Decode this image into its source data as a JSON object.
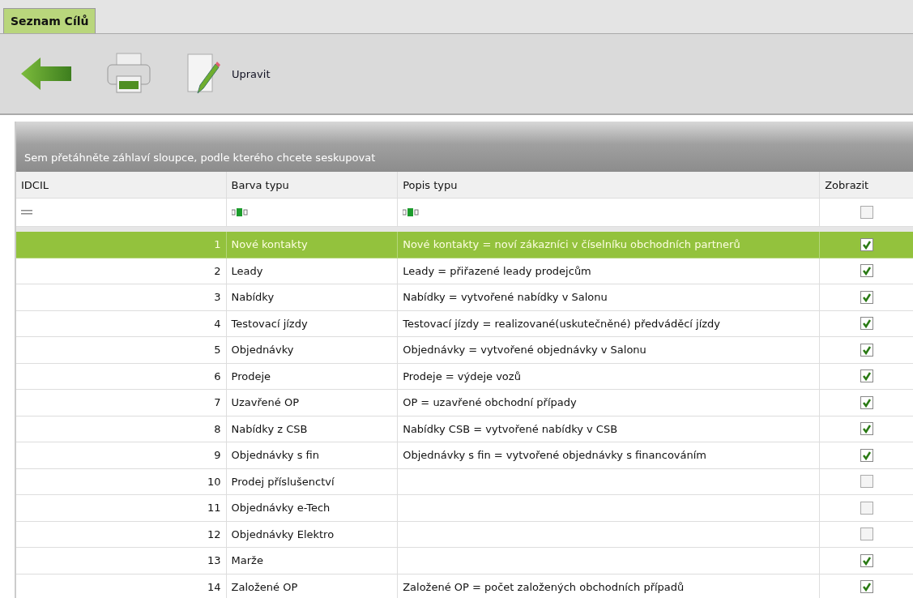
{
  "tabs": [
    {
      "label": "Seznam Cílů",
      "selected": true
    }
  ],
  "toolbar": {
    "edit_label": "Upravit"
  },
  "grid": {
    "group_hint": "Sem přetáhněte záhlaví sloupce, podle kterého chcete seskupovat",
    "columns": [
      "IDCIL",
      "Barva typu",
      "Popis typu",
      "Zobrazit"
    ],
    "filter": {
      "checked": false
    },
    "rows": [
      {
        "id": "1",
        "name": "Nové kontakty",
        "description": "Nové kontakty = noví zákazníci v číselníku obchodních partnerů",
        "shown": true,
        "selected": true
      },
      {
        "id": "2",
        "name": "Leady",
        "description": "Leady = přiřazené leady prodejcům",
        "shown": true,
        "selected": false
      },
      {
        "id": "3",
        "name": "Nabídky",
        "description": "Nabídky = vytvořené nabídky v Salonu",
        "shown": true,
        "selected": false
      },
      {
        "id": "4",
        "name": "Testovací jízdy",
        "description": "Testovací jízdy = realizované(uskutečněné) předváděcí jízdy",
        "shown": true,
        "selected": false
      },
      {
        "id": "5",
        "name": "Objednávky",
        "description": "Objednávky = vytvořené objednávky v Salonu",
        "shown": true,
        "selected": false
      },
      {
        "id": "6",
        "name": "Prodeje",
        "description": "Prodeje = výdeje vozů",
        "shown": true,
        "selected": false
      },
      {
        "id": "7",
        "name": "Uzavřené OP",
        "description": "OP = uzavřené obchodní případy",
        "shown": true,
        "selected": false
      },
      {
        "id": "8",
        "name": "Nabídky z CSB",
        "description": "Nabídky CSB = vytvořené nabídky v CSB",
        "shown": true,
        "selected": false
      },
      {
        "id": "9",
        "name": "Objednávky s fin",
        "description": "Objednávky s fin = vytvořené objednávky s financováním",
        "shown": true,
        "selected": false
      },
      {
        "id": "10",
        "name": "Prodej příslušenctví",
        "description": "",
        "shown": false,
        "selected": false
      },
      {
        "id": "11",
        "name": "Objednávky e-Tech",
        "description": "",
        "shown": false,
        "selected": false
      },
      {
        "id": "12",
        "name": "Objednávky Elektro",
        "description": "",
        "shown": false,
        "selected": false
      },
      {
        "id": "13",
        "name": "Marže",
        "description": "",
        "shown": true,
        "selected": false
      },
      {
        "id": "14",
        "name": "Založené OP",
        "description": "Založené OP = počet založených obchodních případů",
        "shown": true,
        "selected": false
      }
    ]
  }
}
